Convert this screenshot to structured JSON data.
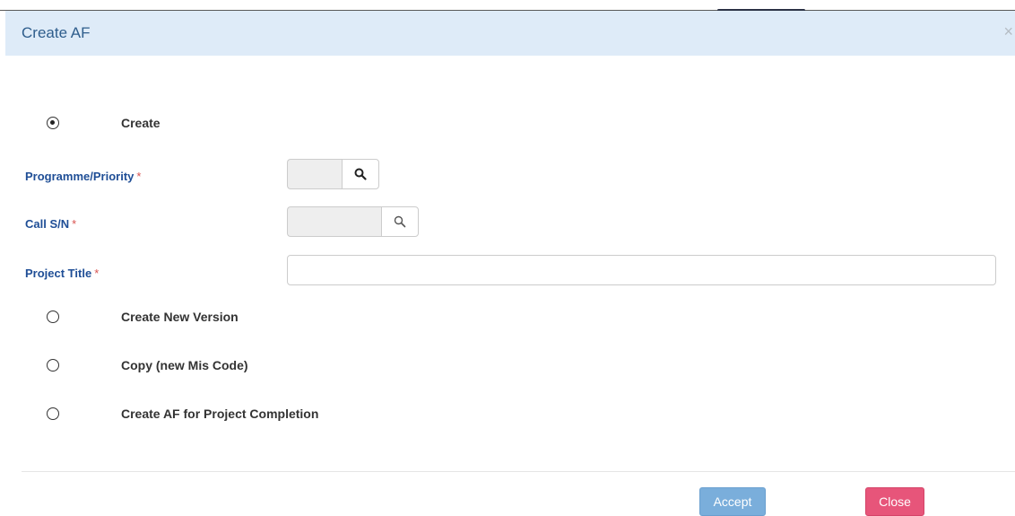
{
  "dialog": {
    "title": "Create AF",
    "close_glyph": "×"
  },
  "options": {
    "create": {
      "label": "Create",
      "checked": true
    },
    "create_new_version": {
      "label": "Create New Version",
      "checked": false
    },
    "copy_new_mis_code": {
      "label": "Copy (new Mis Code)",
      "checked": false
    },
    "create_af_project_completion": {
      "label": "Create AF for Project Completion",
      "checked": false
    }
  },
  "fields": {
    "programme_priority": {
      "label": "Programme/Priority",
      "required_mark": "*",
      "value": ""
    },
    "call_sn": {
      "label": "Call S/N",
      "required_mark": "*",
      "value": ""
    },
    "project_title": {
      "label": "Project Title",
      "required_mark": "*",
      "value": ""
    }
  },
  "footer": {
    "accept_label": "Accept",
    "close_label": "Close"
  },
  "colors": {
    "header_bg": "#deebf8",
    "label_blue": "#1f4e96",
    "required_red": "#d9534f",
    "accept_blue": "#7aaedb",
    "close_pink": "#e7557a"
  },
  "icons": {
    "search": "search-icon",
    "close": "close-icon"
  }
}
